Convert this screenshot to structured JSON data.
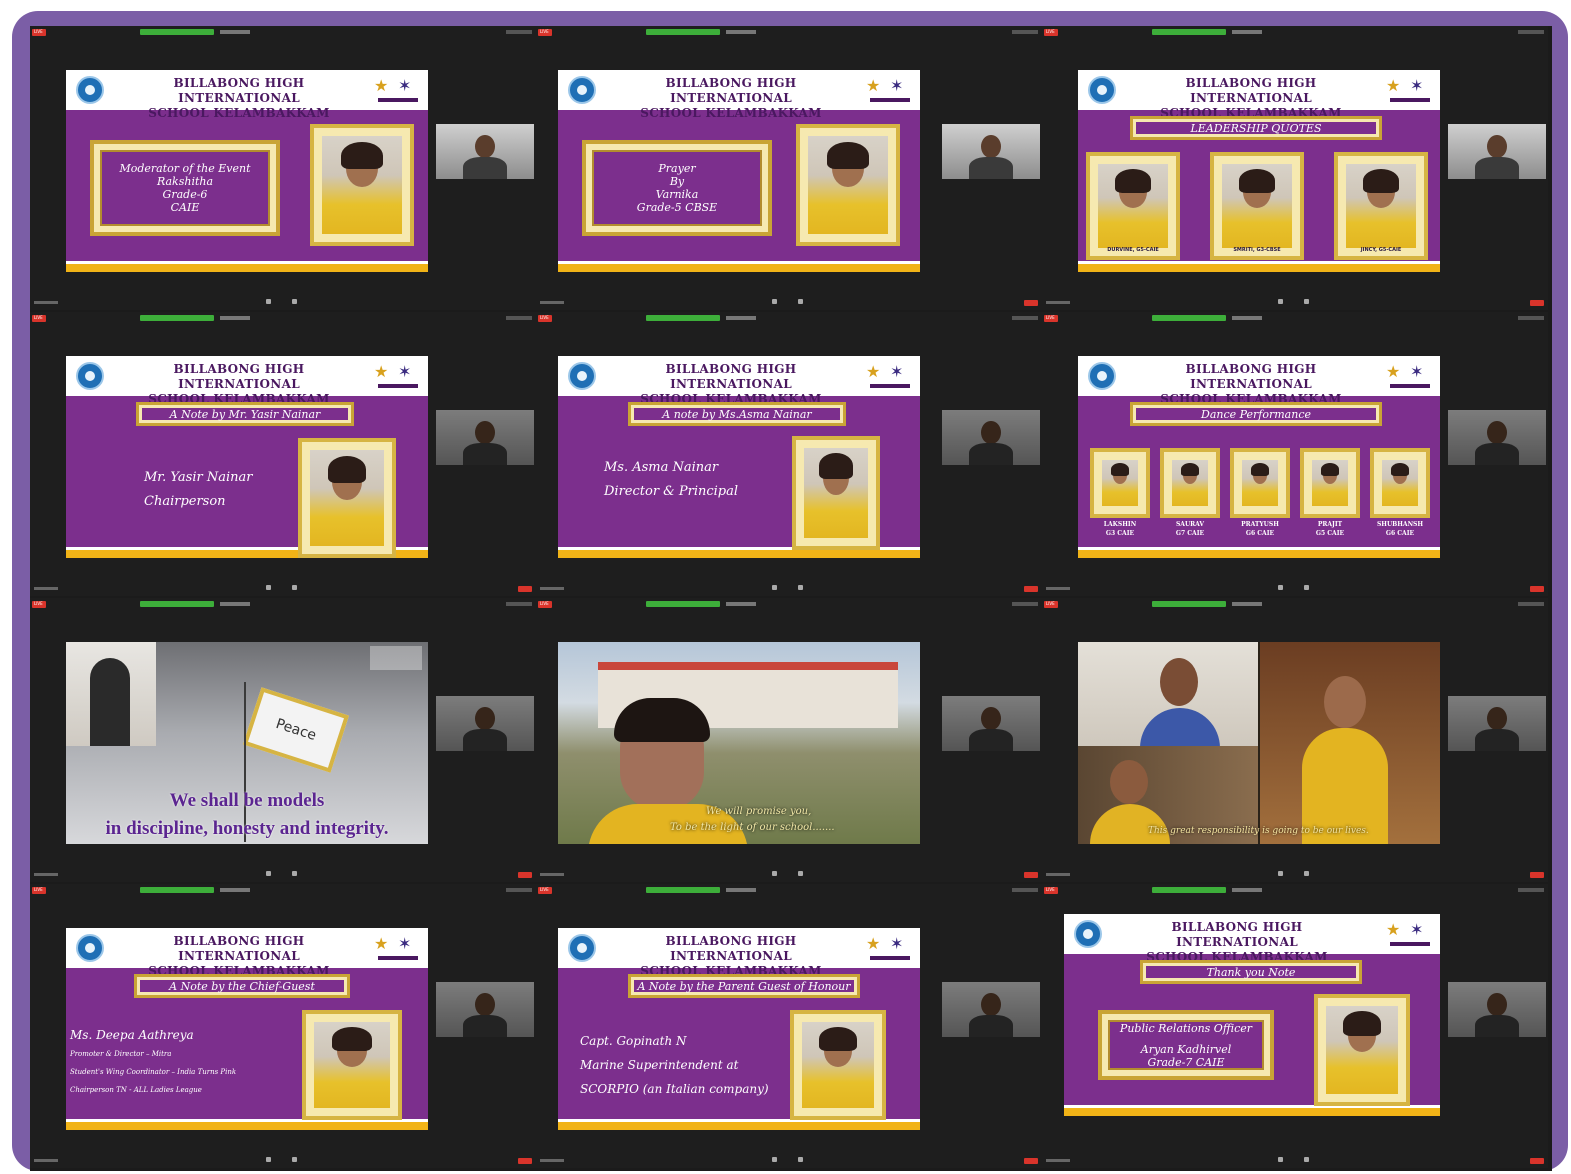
{
  "school": {
    "line1": "BILLABONG HIGH INTERNATIONAL",
    "line2": "SCHOOL  KELAMBAKKAM"
  },
  "toolbar": {
    "live": "LIVE",
    "leave": "Leave"
  },
  "slides": {
    "s1": {
      "caption": "Moderator of the Event\nRakshitha\nGrade-6\nCAIE"
    },
    "s2": {
      "caption": "Prayer\nBy\nVarnika\nGrade-5 CBSE"
    },
    "s3": {
      "header": "LEADERSHIP QUOTES",
      "students": [
        "DURVINE, G5-CAIE",
        "SMRITI, G3-CBSE",
        "JINCY, G5-CAIE"
      ]
    },
    "s4": {
      "header": "A Note by Mr. Yasir Nainar",
      "name": "Mr. Yasir Nainar",
      "role": "Chairperson"
    },
    "s5": {
      "header": "A note by Ms.Asma Nainar",
      "name": "Ms. Asma Nainar",
      "role": "Director & Principal"
    },
    "s6": {
      "header": "Dance Performance",
      "students": [
        {
          "name": "LAKSHIN",
          "grade": "G3 CAIE"
        },
        {
          "name": "SAURAV",
          "grade": "G7 CAIE"
        },
        {
          "name": "PRATYUSH",
          "grade": "G6 CAIE"
        },
        {
          "name": "PRAJIT",
          "grade": "G5 CAIE"
        },
        {
          "name": "SHUBHANSH",
          "grade": "G6 CAIE"
        }
      ]
    },
    "s7": {
      "flag": "Peace",
      "line1": "We shall be models",
      "line2": "in discipline, honesty and integrity."
    },
    "s8": {
      "line1": "We will promise you,",
      "line2": "To be the light of our school......."
    },
    "s9": {
      "line1": "This great responsibility is going to be our lives."
    },
    "s10": {
      "header": "A Note by the Chief-Guest",
      "name": "Ms. Deepa Aathreya",
      "l1": "Promoter & Director – Mitra",
      "l2": "Student's Wing Coordinator – India Turns Pink",
      "l3": "Chairperson TN  - ALL Ladies League"
    },
    "s11": {
      "header": "A Note by the Parent Guest of Honour",
      "name": "Capt. Gopinath N",
      "l1": "Marine Superintendent at",
      "l2": "SCORPIO (an Italian company)"
    },
    "s12": {
      "header": "Thank you Note",
      "role": "Public Relations Officer",
      "name": "Aryan Kadhirvel",
      "grade": "Grade-7 CAIE"
    }
  },
  "colors": {
    "slide_purple": "#7c2f8d",
    "gold": "#c9a435",
    "frame": "#7b5ea6",
    "live_red": "#d9342b",
    "zoom_green": "#3dae3a"
  }
}
